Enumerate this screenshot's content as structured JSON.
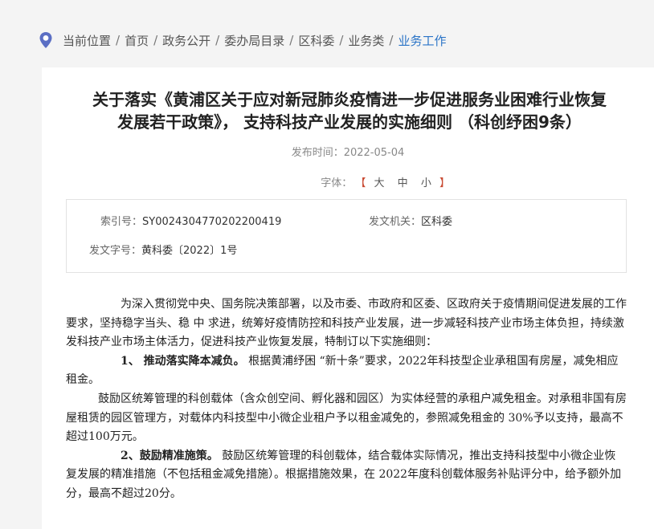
{
  "breadcrumb": {
    "label": "当前位置",
    "items": [
      "首页",
      "政务公开",
      "委办局目录",
      "区科委",
      "业务类"
    ],
    "current": "业务工作"
  },
  "article": {
    "title_line1": "关于落实《黄浦区关于应对新冠肺炎疫情进一步促进服务业困难行业恢复",
    "title_line2": "发展若干政策》， 支持科技产业发展的实施细则 （科创纾困9条）",
    "pubdate_label": "发布时间：",
    "pubdate": "2022-05-04",
    "font_label": "字体：",
    "font_options": [
      "大",
      "中",
      "小"
    ]
  },
  "meta": {
    "index_label": "索引号：",
    "index_value": "SY0024304770202200419",
    "org_label": "发文机关：",
    "org_value": "区科委",
    "docno_label": "发文字号：",
    "docno_value": "黄科委〔2022〕1号"
  },
  "content": {
    "p1": "为深入贯彻党中央、国务院决策部署，以及市委、市政府和区委、区政府关于疫情期间促进发展的工作要求，坚持稳字当头、稳 中 求进，统筹好疫情防控和科技产业发展，进一步减轻科技产业市场主体负担，持续激发科技产业市场主体活力，促进科技产业恢复发展，特制订以下实施细则：",
    "p2_head": "1、 推动落实降本减负。",
    "p2_body": " 根据黄浦纾困 “新十条”要求，2022年科技型企业承租国有房屋，减免相应租金。",
    "p3": "鼓励区统筹管理的科创载体（含众创空间、孵化器和园区）为实体经营的承租户减免租金。对承租非国有房屋租赁的园区管理方，对载体内科技型中小微企业租户予以租金减免的，参照减免租金的 30%予以支持，最高不超过100万元。",
    "p4_head": "2、鼓励精准施策。",
    "p4_body": " 鼓励区统筹管理的科创载体，结合载体实际情况，推出支持科技型中小微企业恢复发展的精准措施（不包括租金减免措施）。根据措施效果，在 2022年度科创载体服务补贴评分中，给予额外加分，最高不超过20分。"
  },
  "colors": {
    "accent": "#2b74c7",
    "bracket": "#c94a32",
    "icon": "#5b6fc4"
  }
}
